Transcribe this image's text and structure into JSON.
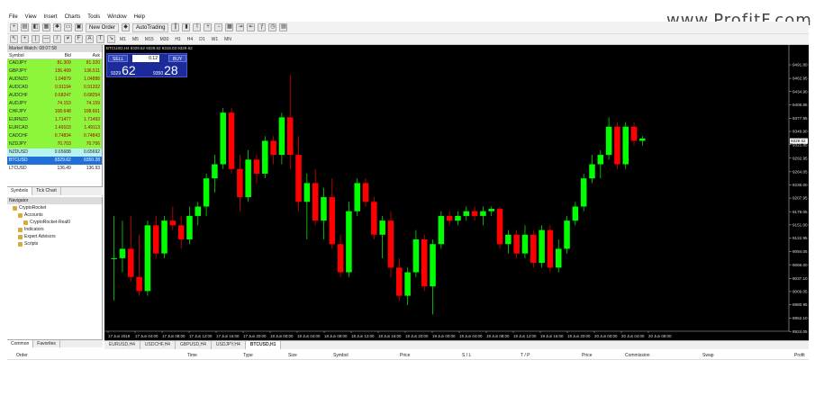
{
  "brand": {
    "text": "www.Profit",
    "f": "F",
    "tail": ".com"
  },
  "menu": [
    "File",
    "View",
    "Insert",
    "Charts",
    "Tools",
    "Window",
    "Help"
  ],
  "toolbar": {
    "new_order": "New Order",
    "auto_trading": "AutoTrading",
    "timeframes": [
      "M1",
      "M5",
      "M15",
      "M30",
      "H1",
      "H4",
      "D1",
      "W1",
      "MN"
    ]
  },
  "market_watch": {
    "title": "Market Watch: 08:07:58",
    "columns": [
      "Symbol",
      "Bid",
      "Ask"
    ],
    "rows": [
      {
        "symbol": "CADJPY",
        "bid": "81.309",
        "ask": "81.320",
        "style": "green"
      },
      {
        "symbol": "GBPJPY",
        "bid": "136.499",
        "ask": "136.511",
        "style": "green"
      },
      {
        "symbol": "AUDNZD",
        "bid": "1.04879",
        "ask": "1.04888",
        "style": "green"
      },
      {
        "symbol": "AUDCAD",
        "bid": "0.91194",
        "ask": "0.91202",
        "style": "green"
      },
      {
        "symbol": "AUDCHF",
        "bid": "0.68247",
        "ask": "0.68254",
        "style": "green"
      },
      {
        "symbol": "AUDJPY",
        "bid": "74.153",
        "ask": "74.159",
        "style": "green"
      },
      {
        "symbol": "CHFJPY",
        "bid": "108.648",
        "ask": "108.661",
        "style": "green"
      },
      {
        "symbol": "EURNZD",
        "bid": "1.71477",
        "ask": "1.71493",
        "style": "green"
      },
      {
        "symbol": "EURCAD",
        "bid": "1.49103",
        "ask": "1.49113",
        "style": "green"
      },
      {
        "symbol": "CADCHF",
        "bid": "0.74834",
        "ask": "0.74843",
        "style": "green"
      },
      {
        "symbol": "NZDJPY",
        "bid": "70.703",
        "ask": "70.706",
        "style": "green"
      },
      {
        "symbol": "NZDUSD",
        "bid": "0.65688",
        "ask": "0.65692",
        "style": "lightblue"
      },
      {
        "symbol": "BTCUSD",
        "bid": "9329.62",
        "ask": "9350.28",
        "style": "blue"
      },
      {
        "symbol": "LTCUSD",
        "bid": "136.49",
        "ask": "136.93",
        "style": "white"
      }
    ],
    "tabs": [
      "Symbols",
      "Tick Chart"
    ]
  },
  "navigator": {
    "title": "Navigator",
    "items": [
      {
        "label": "CryptoRocket",
        "indent": 1
      },
      {
        "label": "Accounts",
        "indent": 2
      },
      {
        "label": "CryptoRocket-Real0",
        "indent": 3
      },
      {
        "label": "Indicators",
        "indent": 2
      },
      {
        "label": "Expert Advisors",
        "indent": 2
      },
      {
        "label": "Scripts",
        "indent": 2
      }
    ],
    "tabs": [
      "Common",
      "Favorites"
    ]
  },
  "chart": {
    "title": "BTCUSD,H4  9329.62 9329.62 9318.03 9329.62",
    "trade": {
      "sell": "SELL",
      "buy": "BUY",
      "lot": "0.12",
      "sell_small": "9329",
      "sell_big": "62",
      "buy_small": "9350",
      "buy_big": "28"
    },
    "tabs": [
      "EURUSD,H4",
      "USDCHF,H4",
      "GBPUSD,H4",
      "USDJPY,H4",
      "BTCUSD,H1"
    ],
    "active_tab": 4
  },
  "chart_data": {
    "type": "candlestick",
    "symbol": "BTCUSD",
    "ylim": [
      8924.5,
      9518.7
    ],
    "y_ticks": [
      "9491.80",
      "9462.95",
      "9434.90",
      "9406.85",
      "9377.95",
      "9349.90",
      "9321.85",
      "9292.95",
      "9264.05",
      "9236.00",
      "9207.95",
      "9179.05",
      "9151.00",
      "9122.95",
      "9094.05",
      "9066.00",
      "9037.10",
      "9009.05",
      "8980.95",
      "8952.10",
      "8924.05"
    ],
    "price_label": "9329.62",
    "x_ticks": [
      "17 Jun 2019",
      "17 Jun 04:00",
      "17 Jun 08:00",
      "17 Jun 12:00",
      "17 Jun 16:00",
      "17 Jun 20:00",
      "18 Jun 00:00",
      "18 Jun 04:00",
      "18 Jun 08:00",
      "18 Jun 12:00",
      "18 Jun 16:00",
      "18 Jun 20:00",
      "19 Jun 00:00",
      "19 Jun 04:00",
      "19 Jun 08:00",
      "19 Jun 12:00",
      "19 Jun 16:00",
      "19 Jun 20:00",
      "20 Jun 00:00",
      "20 Jun 04:00",
      "20 Jun 08:00"
    ],
    "up_color": "#00ff00",
    "down_color": "#ff0000",
    "candles": [
      [
        9080,
        9170,
        8990,
        9080
      ],
      [
        9080,
        9160,
        9050,
        9100
      ],
      [
        9100,
        9170,
        9030,
        9040
      ],
      [
        9040,
        9130,
        9000,
        9010
      ],
      [
        9010,
        9160,
        9000,
        9150
      ],
      [
        9150,
        9170,
        9080,
        9090
      ],
      [
        9090,
        9170,
        9080,
        9160
      ],
      [
        9160,
        9190,
        9140,
        9150
      ],
      [
        9150,
        9170,
        9100,
        9120
      ],
      [
        9120,
        9190,
        9110,
        9170
      ],
      [
        9170,
        9200,
        9150,
        9190
      ],
      [
        9190,
        9260,
        9170,
        9250
      ],
      [
        9250,
        9300,
        9220,
        9280
      ],
      [
        9280,
        9400,
        9270,
        9390
      ],
      [
        9390,
        9400,
        9260,
        9270
      ],
      [
        9270,
        9300,
        9180,
        9210
      ],
      [
        9210,
        9310,
        9200,
        9290
      ],
      [
        9290,
        9300,
        9240,
        9260
      ],
      [
        9260,
        9340,
        9250,
        9330
      ],
      [
        9330,
        9340,
        9280,
        9300
      ],
      [
        9300,
        9390,
        9280,
        9380
      ],
      [
        9380,
        9470,
        9270,
        9300
      ],
      [
        9300,
        9340,
        9180,
        9200
      ],
      [
        9200,
        9260,
        9120,
        9240
      ],
      [
        9240,
        9270,
        9150,
        9160
      ],
      [
        9160,
        9230,
        9120,
        9210
      ],
      [
        9210,
        9250,
        9100,
        9110
      ],
      [
        9110,
        9130,
        9040,
        9050
      ],
      [
        9050,
        9200,
        9040,
        9180
      ],
      [
        9180,
        9250,
        9170,
        9240
      ],
      [
        9240,
        9250,
        9190,
        9200
      ],
      [
        9200,
        9210,
        9120,
        9130
      ],
      [
        9130,
        9170,
        9080,
        9160
      ],
      [
        9160,
        9180,
        9040,
        9060
      ],
      [
        9060,
        9080,
        8990,
        9000
      ],
      [
        9000,
        9060,
        8980,
        9050
      ],
      [
        9050,
        9140,
        9040,
        9120
      ],
      [
        9120,
        9130,
        9010,
        9020
      ],
      [
        9020,
        9120,
        8960,
        9110
      ],
      [
        9110,
        9180,
        9100,
        9170
      ],
      [
        9170,
        9180,
        9150,
        9160
      ],
      [
        9160,
        9180,
        9150,
        9170
      ],
      [
        9170,
        9190,
        9160,
        9180
      ],
      [
        9180,
        9190,
        9160,
        9170
      ],
      [
        9170,
        9190,
        9150,
        9180
      ],
      [
        9180,
        9190,
        9170,
        9185
      ],
      [
        9185,
        9190,
        9100,
        9110
      ],
      [
        9110,
        9140,
        9090,
        9130
      ],
      [
        9130,
        9140,
        9080,
        9090
      ],
      [
        9090,
        9150,
        9080,
        9130
      ],
      [
        9130,
        9140,
        9060,
        9070
      ],
      [
        9070,
        9150,
        9060,
        9140
      ],
      [
        9140,
        9150,
        9050,
        9060
      ],
      [
        9060,
        9120,
        9050,
        9100
      ],
      [
        9100,
        9170,
        9090,
        9160
      ],
      [
        9160,
        9200,
        9150,
        9190
      ],
      [
        9190,
        9260,
        9180,
        9250
      ],
      [
        9250,
        9300,
        9240,
        9280
      ],
      [
        9280,
        9310,
        9250,
        9300
      ],
      [
        9300,
        9380,
        9290,
        9360
      ],
      [
        9360,
        9370,
        9270,
        9280
      ],
      [
        9280,
        9370,
        9270,
        9360
      ],
      [
        9360,
        9370,
        9320,
        9330
      ],
      [
        9330,
        9340,
        9320,
        9335
      ]
    ]
  },
  "terminal": {
    "columns": [
      "Order",
      "Time",
      "Type",
      "Size",
      "Symbol",
      "Price",
      "S / L",
      "T / P",
      "Price",
      "Commission",
      "Swap",
      "Profit"
    ]
  }
}
